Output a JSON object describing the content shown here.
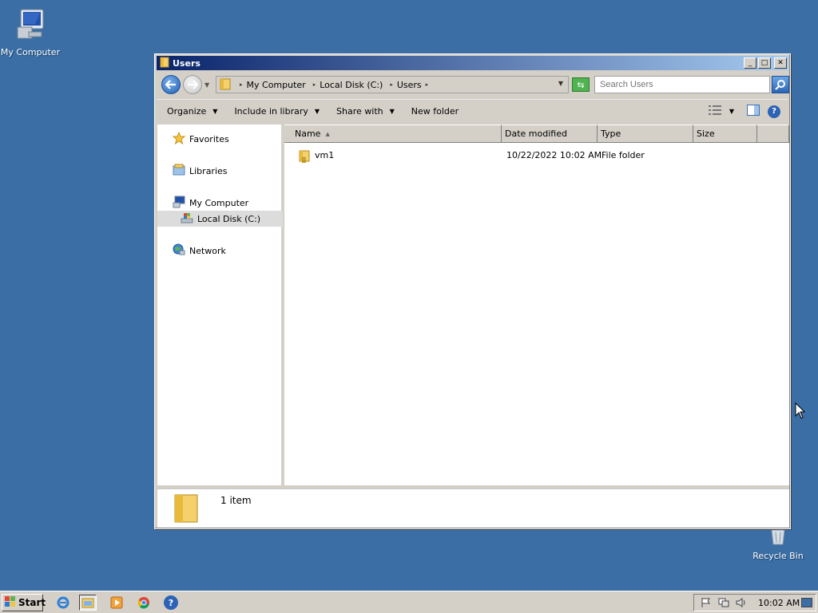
{
  "desktop": {
    "icons": [
      {
        "label": "My Computer",
        "icon": "my-computer-icon"
      },
      {
        "label": "Recycle Bin",
        "icon": "recycle-bin-icon"
      }
    ]
  },
  "window": {
    "title": "Users",
    "controls": {
      "minimize": "_",
      "maximize": "□",
      "close": "✕"
    },
    "address": {
      "crumbs": [
        "My Computer",
        "Local Disk (C:)",
        "Users"
      ]
    },
    "search": {
      "placeholder": "Search Users"
    },
    "toolbar": {
      "organize": "Organize",
      "include_in_library": "Include in library",
      "share_with": "Share with",
      "new_folder": "New folder"
    },
    "nav_pane": {
      "favorites": "Favorites",
      "libraries": "Libraries",
      "my_computer": "My Computer",
      "local_disk": "Local Disk (C:)",
      "network": "Network"
    },
    "columns": {
      "name": "Name",
      "date_modified": "Date modified",
      "type": "Type",
      "size": "Size"
    },
    "files": [
      {
        "name": "vm1",
        "date_modified": "10/22/2022 10:02 AM",
        "type": "File folder",
        "size": ""
      }
    ],
    "details": {
      "item_count": "1 item"
    }
  },
  "taskbar": {
    "start_label": "Start",
    "quick_launch": [
      "internet-explorer-icon",
      "explorer-icon",
      "media-player-icon",
      "chrome-icon",
      "help-icon"
    ],
    "clock": "10:02 AM"
  },
  "colors": {
    "desktop": "#3a6ea5",
    "titlebar_start": "#0a246a",
    "titlebar_end": "#a6caf0",
    "chrome": "#d4d0c8"
  }
}
